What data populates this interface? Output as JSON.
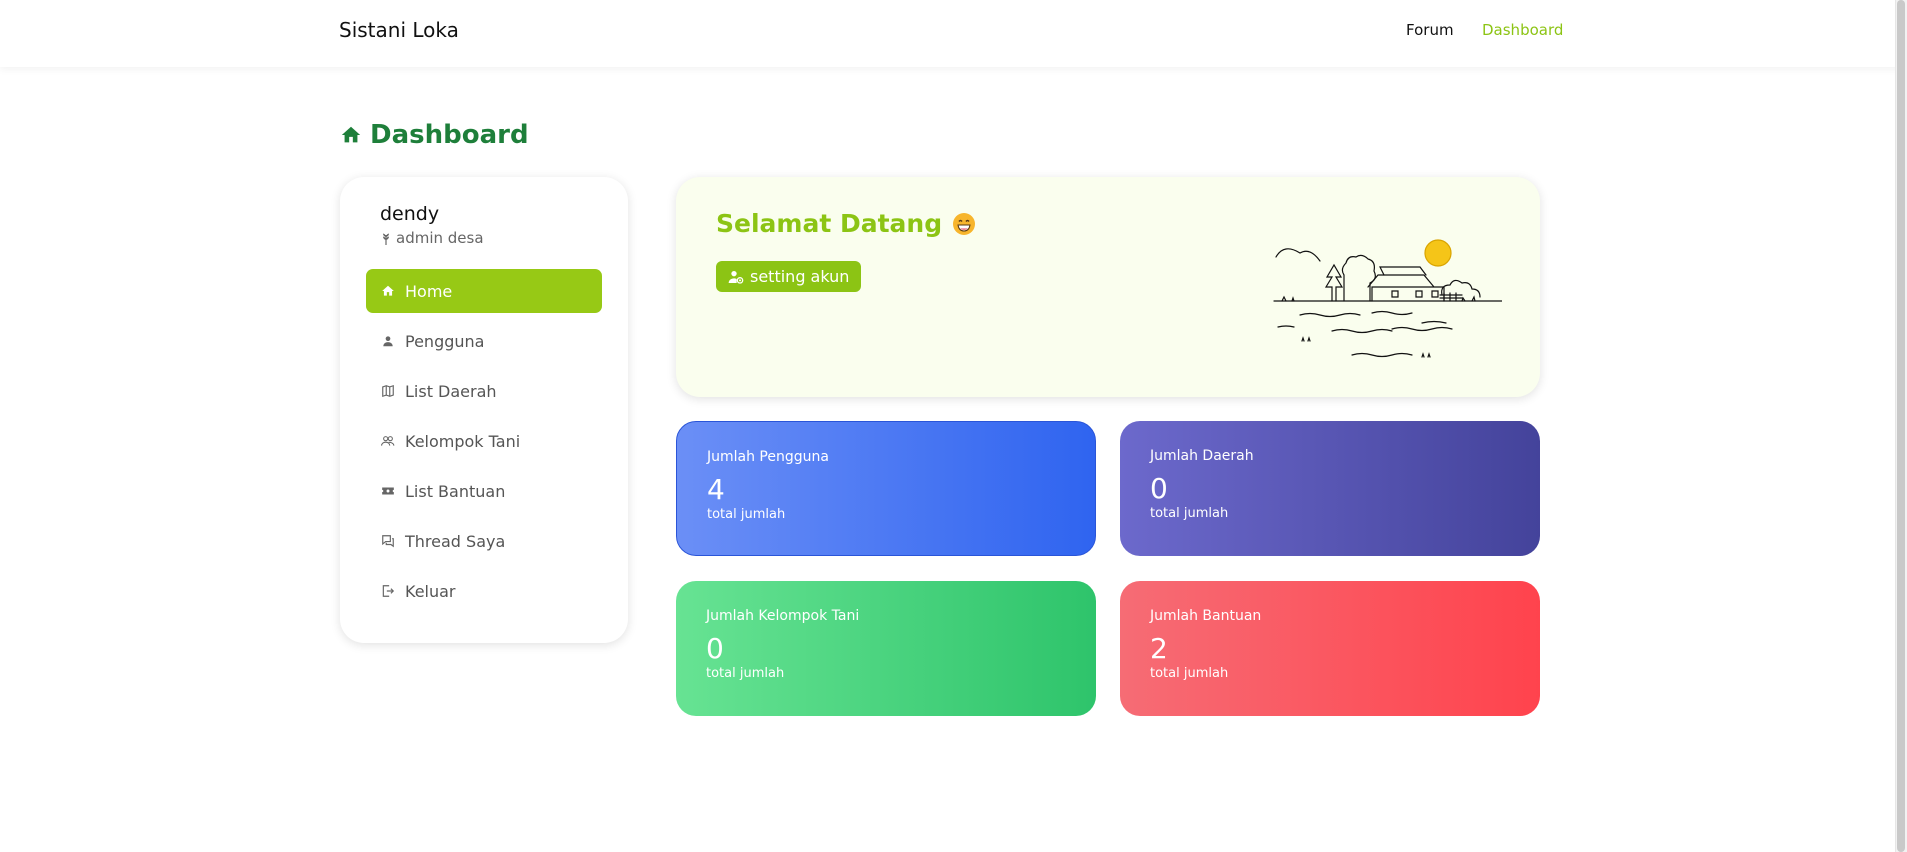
{
  "navbar": {
    "brand": "Sistani Loka",
    "links": [
      {
        "label": "Forum"
      },
      {
        "label": "Dashboard"
      }
    ]
  },
  "page": {
    "title": "Dashboard",
    "title_icon": "home-icon"
  },
  "sidebar": {
    "user": {
      "name": "dendy",
      "role": "admin desa",
      "role_icon": "wheat-icon"
    },
    "items": [
      {
        "label": "Home",
        "icon": "home-icon",
        "active": true
      },
      {
        "label": "Pengguna",
        "icon": "user-icon",
        "active": false
      },
      {
        "label": "List Daerah",
        "icon": "map-icon",
        "active": false
      },
      {
        "label": "Kelompok Tani",
        "icon": "group-icon",
        "active": false
      },
      {
        "label": "List Bantuan",
        "icon": "ticket-icon",
        "active": false
      },
      {
        "label": "Thread Saya",
        "icon": "chat-icon",
        "active": false
      },
      {
        "label": "Keluar",
        "icon": "logout-icon",
        "active": false
      }
    ]
  },
  "welcome": {
    "title": "Selamat Datang",
    "emoji": "grinning-face-icon",
    "button_label": "setting akun"
  },
  "stats": [
    {
      "label": "Jumlah Pengguna",
      "value": "4",
      "sub": "total jumlah",
      "color": "#2f64f0"
    },
    {
      "label": "Jumlah Daerah",
      "value": "0",
      "sub": "total jumlah",
      "color": "#44439b"
    },
    {
      "label": "Jumlah Kelompok Tani",
      "value": "0",
      "sub": "total jumlah",
      "color": "#2ec46b"
    },
    {
      "label": "Jumlah Bantuan",
      "value": "2",
      "sub": "total jumlah",
      "color": "#ff434d"
    }
  ],
  "colors": {
    "accent": "#8cc414",
    "title_green": "#1e7f3a"
  }
}
